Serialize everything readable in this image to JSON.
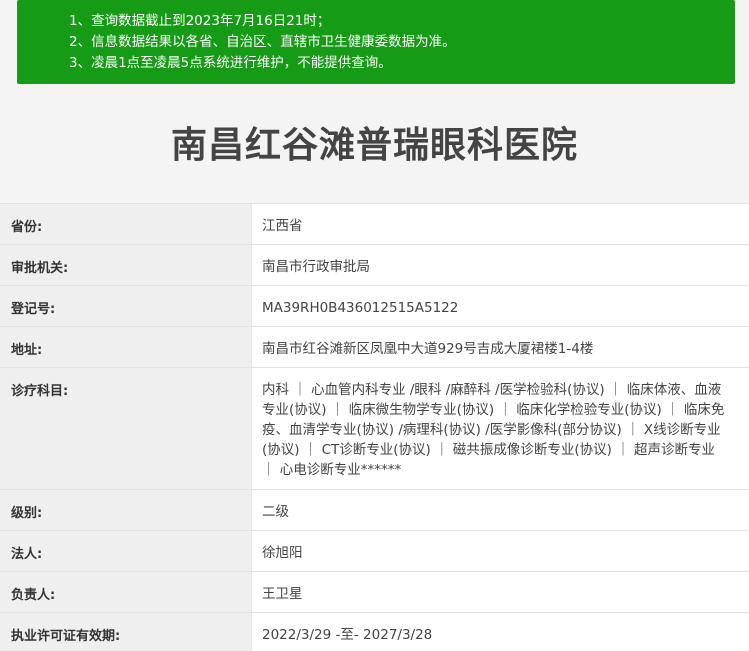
{
  "notice": {
    "lines": [
      "1、查询数据截止到2023年7月16日21时；",
      "2、信息数据结果以各省、自治区、直辖市卫生健康委数据为准。",
      "3、凌晨1点至凌晨5点系统进行维护，不能提供查询。"
    ]
  },
  "hospital": {
    "name": "南昌红谷滩普瑞眼科医院"
  },
  "details": {
    "province": {
      "label": "省份:",
      "value": "江西省"
    },
    "authority": {
      "label": "审批机关:",
      "value": "南昌市行政审批局"
    },
    "registration": {
      "label": "登记号:",
      "value": "MA39RH0B436012515A5122"
    },
    "address": {
      "label": "地址:",
      "value": "南昌市红谷滩新区凤凰中大道929号吉成大厦裙楼1-4楼"
    },
    "subjects": {
      "label": "诊疗科目:",
      "value": "内科 ｜ 心血管内科专业 /眼科 /麻醉科 /医学检验科(协议) ｜ 临床体液、血液专业(协议) ｜ 临床微生物学专业(协议) ｜ 临床化学检验专业(协议) ｜ 临床免疫、血清学专业(协议) /病理科(协议) /医学影像科(部分协议) ｜ X线诊断专业(协议) ｜ CT诊断专业(协议) ｜ 磁共振成像诊断专业(协议) ｜ 超声诊断专业 ｜ 心电诊断专业******"
    },
    "level": {
      "label": "级别:",
      "value": "二级"
    },
    "legal_person": {
      "label": "法人:",
      "value": "徐旭阳"
    },
    "responsible": {
      "label": "负责人:",
      "value": "王卫星"
    },
    "validity": {
      "label": "执业许可证有效期:",
      "value": "2022/3/29 -至- 2027/3/28"
    }
  }
}
